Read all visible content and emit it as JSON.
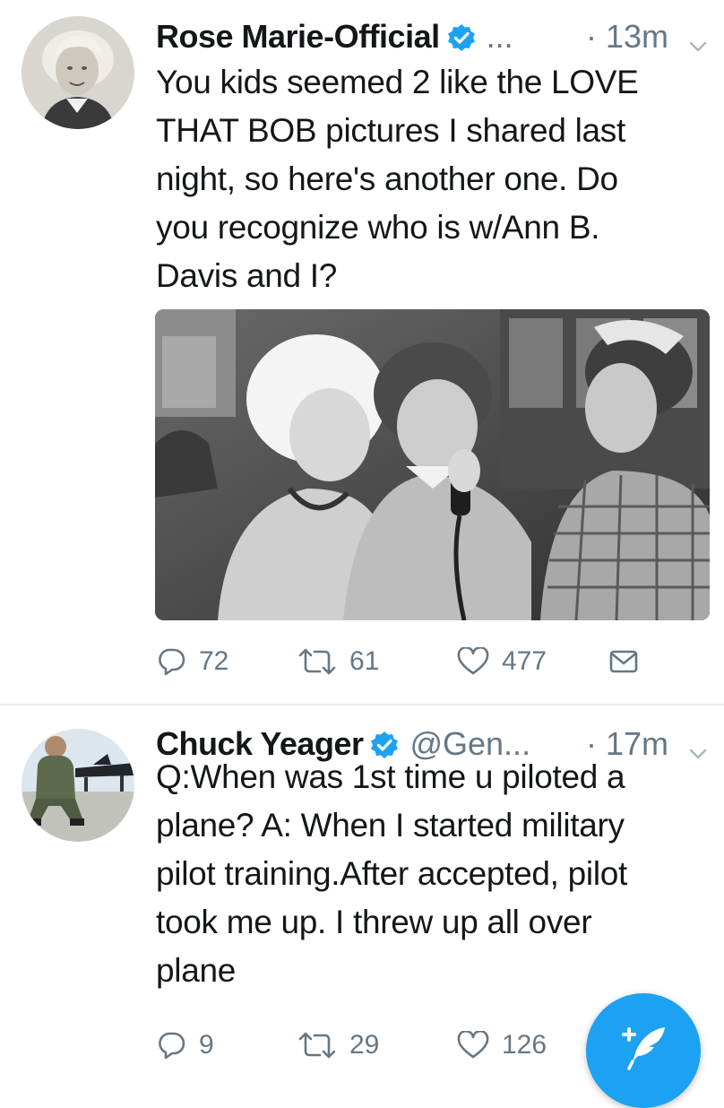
{
  "tweets": [
    {
      "name": "Rose Marie-Official",
      "handle": "...",
      "time": "· 13m",
      "text": "You kids seemed 2 like the LOVE\nTHAT BOB pictures I shared last\nnight, so here's another one. Do\nyou recognize who is w/Ann B.\nDavis and I?",
      "replies": "72",
      "retweets": "61",
      "likes": "477"
    },
    {
      "name": "Chuck Yeager",
      "handle": "@Gen...",
      "time": "· 17m",
      "text": "Q:When was 1st time u piloted a\nplane? A: When I started military\npilot training.After accepted, pilot\ntook me up. I threw up all over\nplane",
      "replies": "9",
      "retweets": "29",
      "likes": "126"
    }
  ],
  "colors": {
    "accent": "#1da1f2",
    "muted": "#657786",
    "text": "#14171a",
    "divider": "#e6ecf0"
  },
  "icons": [
    "verified-badge-icon",
    "chevron-down-icon",
    "reply-icon",
    "retweet-icon",
    "like-icon",
    "direct-message-icon",
    "compose-tweet-icon"
  ]
}
